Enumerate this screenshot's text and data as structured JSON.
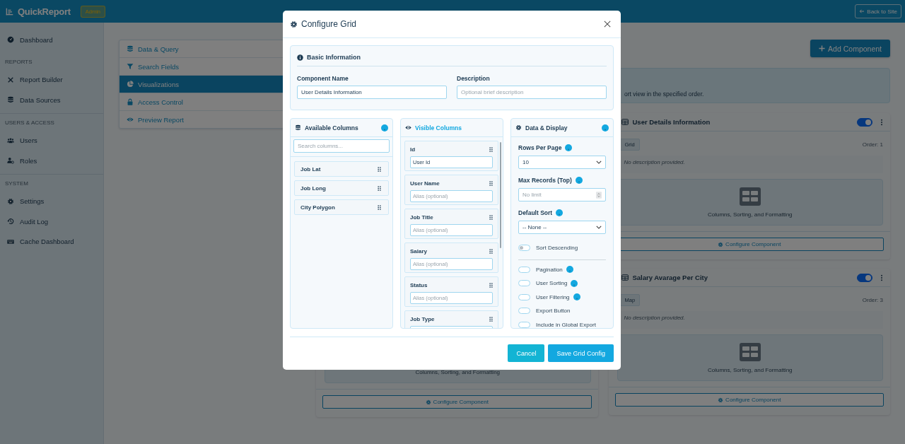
{
  "app": {
    "brand": "QuickReport",
    "role_badge": "Admin",
    "back_button": "Back to Site"
  },
  "sidebar": {
    "groups": [
      {
        "items": [
          {
            "label": "Dashboard",
            "selected": false
          }
        ]
      },
      {
        "heading": "REPORTS",
        "items": [
          {
            "label": "Report Builder",
            "selected": false
          },
          {
            "label": "Data Sources",
            "selected": false
          }
        ]
      },
      {
        "heading": "USERS & ACCESS",
        "items": [
          {
            "label": "Users",
            "selected": false
          },
          {
            "label": "Roles",
            "selected": false
          }
        ]
      },
      {
        "heading": "SYSTEM",
        "items": [
          {
            "label": "Settings",
            "selected": false
          },
          {
            "label": "Audit Log",
            "selected": false
          },
          {
            "label": "Cache Dashboard",
            "selected": false
          }
        ]
      }
    ]
  },
  "tabs": [
    {
      "label": "Data & Query",
      "selected": false
    },
    {
      "label": "Search Fields",
      "selected": false
    },
    {
      "label": "Visualizations",
      "selected": true
    },
    {
      "label": "Access Control",
      "selected": false
    },
    {
      "label": "Preview Report",
      "selected": false
    }
  ],
  "add_button": "Add Component",
  "banner_text": "ort view in the specified order.",
  "cards": {
    "left": [
      {
        "preview_caption": "Columns, Sorting, and Formatting",
        "configure_button": "Configure Component"
      }
    ],
    "right": [
      {
        "title": "User Details Information",
        "on": true,
        "type_badge": "Grid",
        "order": "Order: 1",
        "description": "No description provided.",
        "preview_caption": "Columns, Sorting, and Formatting",
        "configure_button": "Configure Component"
      },
      {
        "title": "Salary Avarage Per City",
        "on": true,
        "type_badge": "Map",
        "order": "Order: 3",
        "description": "No description provided.",
        "preview_caption": "Columns, Sorting, and Formatting",
        "configure_button": "Configure Component"
      }
    ]
  },
  "modal": {
    "title": "Configure Grid",
    "basic": {
      "heading": "Basic Information",
      "fields": [
        {
          "label": "Component Name",
          "value": "User Details Information"
        },
        {
          "label": "Description",
          "placeholder": "Optional brief description"
        }
      ]
    },
    "available": {
      "heading": "Available Columns",
      "search_placeholder": "Search columns...",
      "items": [
        "Job Lat",
        "Job Long",
        "City Polygon"
      ]
    },
    "visible": {
      "heading": "Visible Columns",
      "items": [
        {
          "name": "Id",
          "value": "User Id"
        },
        {
          "name": "User Name",
          "placeholder": "Alias (optional)"
        },
        {
          "name": "Job Title",
          "placeholder": "Alias (optional)"
        },
        {
          "name": "Salary",
          "placeholder": "Alias (optional)"
        },
        {
          "name": "Status",
          "placeholder": "Alias (optional)"
        },
        {
          "name": "Job Type"
        }
      ]
    },
    "display": {
      "heading": "Data & Display",
      "fields": [
        {
          "kind": "select",
          "label": "Rows Per Page",
          "value": "10"
        },
        {
          "kind": "number",
          "label": "Max Records (Top)",
          "placeholder": "No limit"
        },
        {
          "kind": "select",
          "label": "Default Sort",
          "value": "-- None --"
        }
      ],
      "sort_descending": {
        "label": "Sort Descending",
        "on": false
      },
      "options": [
        {
          "label": "Pagination",
          "on": false,
          "help": true
        },
        {
          "label": "User Sorting",
          "on": false,
          "help": true
        },
        {
          "label": "User Filtering",
          "on": false,
          "help": true
        },
        {
          "label": "Export Button",
          "on": false,
          "help": false
        },
        {
          "label": "Include in Global Export",
          "on": false,
          "help": false
        }
      ]
    },
    "cancel_button": "Cancel",
    "save_button": "Save Grid Config"
  }
}
